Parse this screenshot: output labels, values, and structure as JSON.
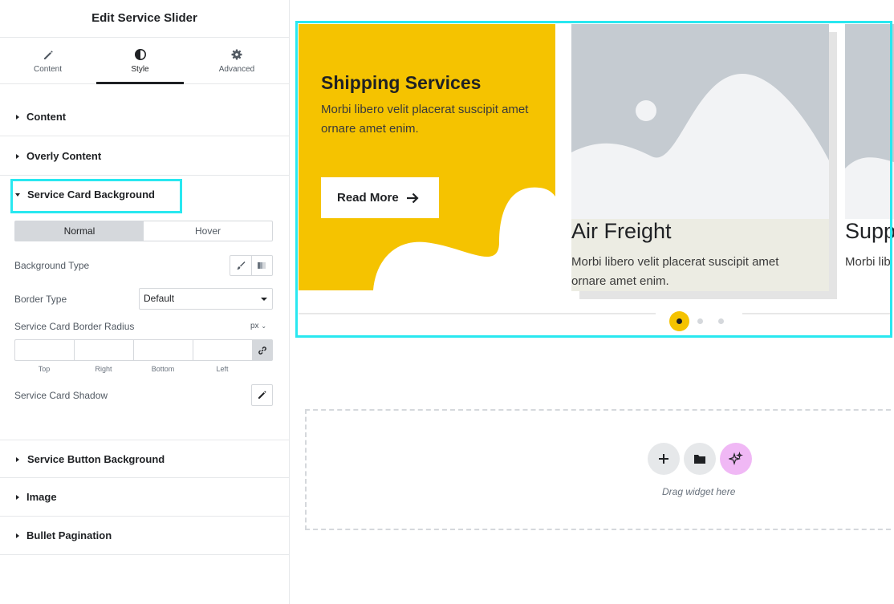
{
  "panel": {
    "title": "Edit Service Slider",
    "tabs": [
      {
        "label": "Content",
        "icon": "pencil-icon"
      },
      {
        "label": "Style",
        "icon": "contrast-icon"
      },
      {
        "label": "Advanced",
        "icon": "gear-icon"
      }
    ],
    "active_tab": "Style",
    "sections": {
      "content": "Content",
      "overly_content": "Overly Content",
      "service_card_background": "Service Card Background",
      "service_button_background": "Service Button Background",
      "image": "Image",
      "bullet_pagination": "Bullet Pagination"
    },
    "state_toggle": {
      "normal": "Normal",
      "hover": "Hover",
      "selected": "Normal"
    },
    "background_type_label": "Background Type",
    "border_type_label": "Border Type",
    "border_type_value": "Default",
    "border_radius_label": "Service Card Border Radius",
    "border_radius_unit": "px",
    "dimension_labels": {
      "top": "Top",
      "right": "Right",
      "bottom": "Bottom",
      "left": "Left"
    },
    "shadow_label": "Service Card Shadow"
  },
  "slider": {
    "card1": {
      "title": "Shipping Services",
      "text": "Morbi libero velit placerat suscipit amet ornare amet enim.",
      "button": "Read More"
    },
    "card2": {
      "title": "Air Freight",
      "text": "Morbi libero velit placerat suscipit amet ornare amet enim."
    },
    "card3": {
      "title": "Supp",
      "text": "Morbi lib ornare am"
    },
    "pagination": {
      "count": 3,
      "active_index": 0
    }
  },
  "drop_zone": {
    "text": "Drag widget here"
  },
  "colors": {
    "accent_yellow": "#f5c300",
    "highlight_cyan": "#29e8f0",
    "ai_button": "#f0b8f5",
    "placeholder_gray": "#c5cbd1"
  }
}
